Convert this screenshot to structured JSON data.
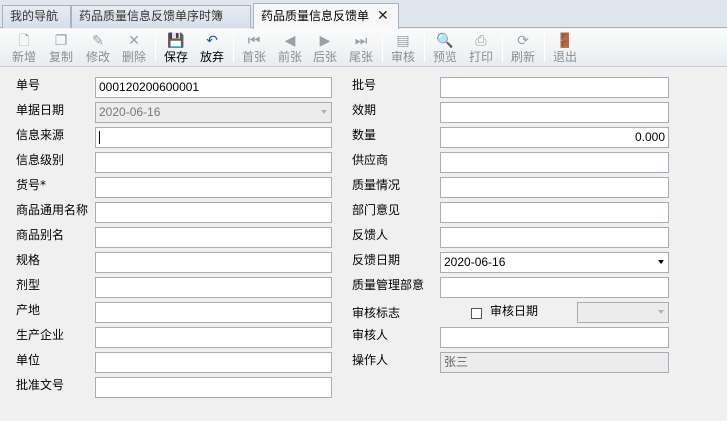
{
  "tabs": [
    {
      "label": "我的导航"
    },
    {
      "label": "药品质量信息反馈单序时簿"
    },
    {
      "label": "药品质量信息反馈单"
    }
  ],
  "toolbar": {
    "new": "新增",
    "copy": "复制",
    "edit": "修改",
    "delete": "删除",
    "save": "保存",
    "abandon": "放弃",
    "first": "首张",
    "prev": "前张",
    "next": "后张",
    "last": "尾张",
    "audit": "审核",
    "preview": "预览",
    "print": "打印",
    "refresh": "刷新",
    "exit": "退出"
  },
  "form": {
    "doc_no": {
      "label": "单号",
      "value": "000120200600001"
    },
    "doc_date": {
      "label": "单据日期",
      "value": "2020-06-16"
    },
    "info_source": {
      "label": "信息来源",
      "value": ""
    },
    "info_level": {
      "label": "信息级别",
      "value": ""
    },
    "item_no": {
      "label": "货号*",
      "value": ""
    },
    "generic_name": {
      "label": "商品通用名称",
      "value": ""
    },
    "alias": {
      "label": "商品别名",
      "value": ""
    },
    "spec": {
      "label": "规格",
      "value": ""
    },
    "dosage_form": {
      "label": "剂型",
      "value": ""
    },
    "origin": {
      "label": "产地",
      "value": ""
    },
    "manufacturer": {
      "label": "生产企业",
      "value": ""
    },
    "unit": {
      "label": "单位",
      "value": ""
    },
    "approval_no": {
      "label": "批准文号",
      "value": ""
    },
    "batch_no": {
      "label": "批号",
      "value": ""
    },
    "expiry": {
      "label": "效期",
      "value": ""
    },
    "quantity": {
      "label": "数量",
      "value": "0.000"
    },
    "supplier": {
      "label": "供应商",
      "value": ""
    },
    "quality_status": {
      "label": "质量情况",
      "value": ""
    },
    "dept_opinion": {
      "label": "部门意见",
      "value": ""
    },
    "feedback_person": {
      "label": "反馈人",
      "value": ""
    },
    "feedback_date": {
      "label": "反馈日期",
      "value": "2020-06-16"
    },
    "qm_opinion": {
      "label": "质量管理部意",
      "value": ""
    },
    "audit_flag": {
      "label": "审核标志",
      "checked": false
    },
    "audit_date": {
      "label": "审核日期",
      "value": ""
    },
    "auditor": {
      "label": "审核人",
      "value": ""
    },
    "operator": {
      "label": "操作人",
      "value": "张三"
    }
  }
}
